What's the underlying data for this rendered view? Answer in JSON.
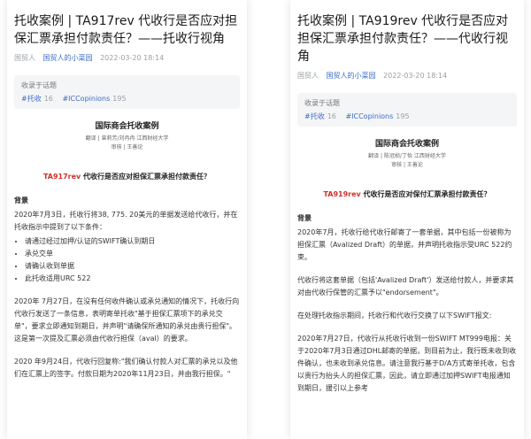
{
  "left": {
    "title": "托收案例 | TA917rev 代收行是否应对担保汇票承担付款责任？——托收行视角",
    "source": "国贸人",
    "account": "国贸人的小菜园",
    "date": "2022-03-20 18:14",
    "topic_label": "收录于话题",
    "tags": [
      {
        "name": "#托收",
        "count": "16"
      },
      {
        "name": "#ICCopinions",
        "count": "195"
      }
    ],
    "header": "国际商会托收案例",
    "translator": "翻译 | 曾莉芳/刘冉冉 江西财经大学",
    "reviewer": "审核 | 王善论",
    "case_code": "TA917rev",
    "case_title": " 代收行是否应对担保汇票承担付款责任？",
    "section": "背景",
    "para1": "2020年7月3日，托收行将38, 775. 20美元的单据发送给代收行，并在托收指示中提到了以下条件：",
    "bullets": [
      "请通过经过加押/认证的SWIFT确认到期日",
      "承兑交单",
      "请确认收到单据",
      "此托收适用URC 522"
    ],
    "para2": "2020年 7月27日，在没有任何收件确认或承兑通知的情况下，托收行向代收行发送了一条信息，表明寄单托收\"基于担保汇票项下的承兑交单\"，要求立即通知到期日，并声明\"请确保所通知的承兑由贵行担保\"。这是第一次提及汇票必须由代收行担保（aval）的要求。",
    "para3": "2020 年9月24日，代收行回复称:\"我们确认付款人对汇票的承兑以及他们在汇票上的签字。付款日期为2020年11月23日，并由我行担保。\""
  },
  "right": {
    "title": "托收案例 | TA919rev 代收行是否应对担保汇票承担付款责任？——代收行视角",
    "source": "国贸人",
    "account": "国贸人的小菜园",
    "date": "2022-03-20 18:14",
    "topic_label": "收录于话题",
    "tags": [
      {
        "name": "#托收",
        "count": "16"
      },
      {
        "name": "#ICCopinions",
        "count": "195"
      }
    ],
    "header": "国际商会托收案例",
    "translator": "翻译 | 陈冠桢/丁怡 江西财经大学",
    "reviewer": "审核 | 王善论",
    "case_code": "TA919rev",
    "case_title": " 代收行是否应对保付汇票承担付款责任？",
    "section": "背景",
    "para1": "2020年7月，托收行给代收行邮寄了一套单据，其中包括一份被称为担保汇票（Avalized Draft）的单据，并声明托收指示受URC 522约束。",
    "para2": "代收行将这套单据（包括'Avalized Draft'）发送给付款人，并要求其对由代收行保管的汇票予以\"endorsement\"。",
    "para3": "在处理托收指示期间，托收行和代收行交换了以下SWIFT报文:",
    "para4": "2020年7月27日，代收行从托收行收到一份SWIFT MT999电报：关于2020年7月3日通过DHL邮寄的单据，到目前为止，我行既未收到收件确认，也未收到承兑信息。请注意我行基于D/A方式寄单托收，包含以贵行为抬头人的担保汇票，因此，请立即通过加押SWIFT电报通知到期日，援引以上参考"
  }
}
